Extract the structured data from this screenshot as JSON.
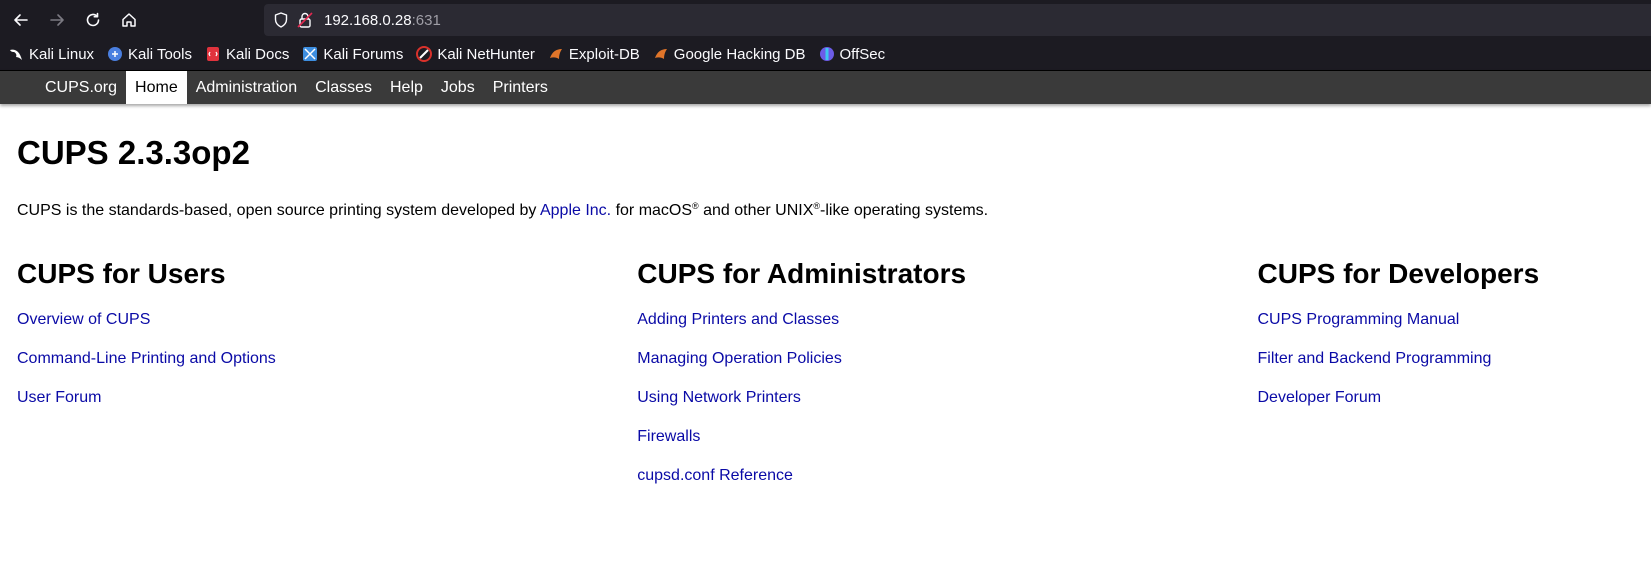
{
  "browser": {
    "url_host": "192.168.0.28",
    "url_port": ":631",
    "bookmarks": [
      {
        "label": "Kali Linux",
        "icon": "kali-dragon-icon",
        "color": "#ffffff"
      },
      {
        "label": "Kali Tools",
        "icon": "kali-tools-icon",
        "color": "#4a7fe0"
      },
      {
        "label": "Kali Docs",
        "icon": "kali-docs-icon",
        "color": "#e0333d"
      },
      {
        "label": "Kali Forums",
        "icon": "kali-forums-icon",
        "color": "#3d8ee0"
      },
      {
        "label": "Kali NetHunter",
        "icon": "nethunter-icon",
        "color": "#d9312b"
      },
      {
        "label": "Exploit-DB",
        "icon": "exploit-db-icon",
        "color": "#e0752a"
      },
      {
        "label": "Google Hacking DB",
        "icon": "ghdb-icon",
        "color": "#e0752a"
      },
      {
        "label": "OffSec",
        "icon": "offsec-icon",
        "color": "#6c5ce7"
      }
    ]
  },
  "cups_nav": {
    "items": [
      {
        "label": "CUPS.org",
        "active": false
      },
      {
        "label": "Home",
        "active": true
      },
      {
        "label": "Administration",
        "active": false
      },
      {
        "label": "Classes",
        "active": false
      },
      {
        "label": "Help",
        "active": false
      },
      {
        "label": "Jobs",
        "active": false
      },
      {
        "label": "Printers",
        "active": false
      }
    ]
  },
  "page": {
    "title": "CUPS 2.3.3op2",
    "intro": {
      "before_link": "CUPS is the standards-based, open source printing system developed by ",
      "link": "Apple Inc.",
      "after_link_1": " for macOS",
      "reg1": "®",
      "after_link_2": " and other UNIX",
      "reg2": "®",
      "after_link_3": "-like operating systems."
    },
    "columns": [
      {
        "heading": "CUPS for Users",
        "links": [
          "Overview of CUPS",
          "Command-Line Printing and Options",
          "User Forum"
        ]
      },
      {
        "heading": "CUPS for Administrators",
        "links": [
          "Adding Printers and Classes",
          "Managing Operation Policies",
          "Using Network Printers",
          "Firewalls",
          "cupsd.conf Reference"
        ]
      },
      {
        "heading": "CUPS for Developers",
        "links": [
          "CUPS Programming Manual",
          "Filter and Backend Programming",
          "Developer Forum"
        ]
      }
    ]
  }
}
